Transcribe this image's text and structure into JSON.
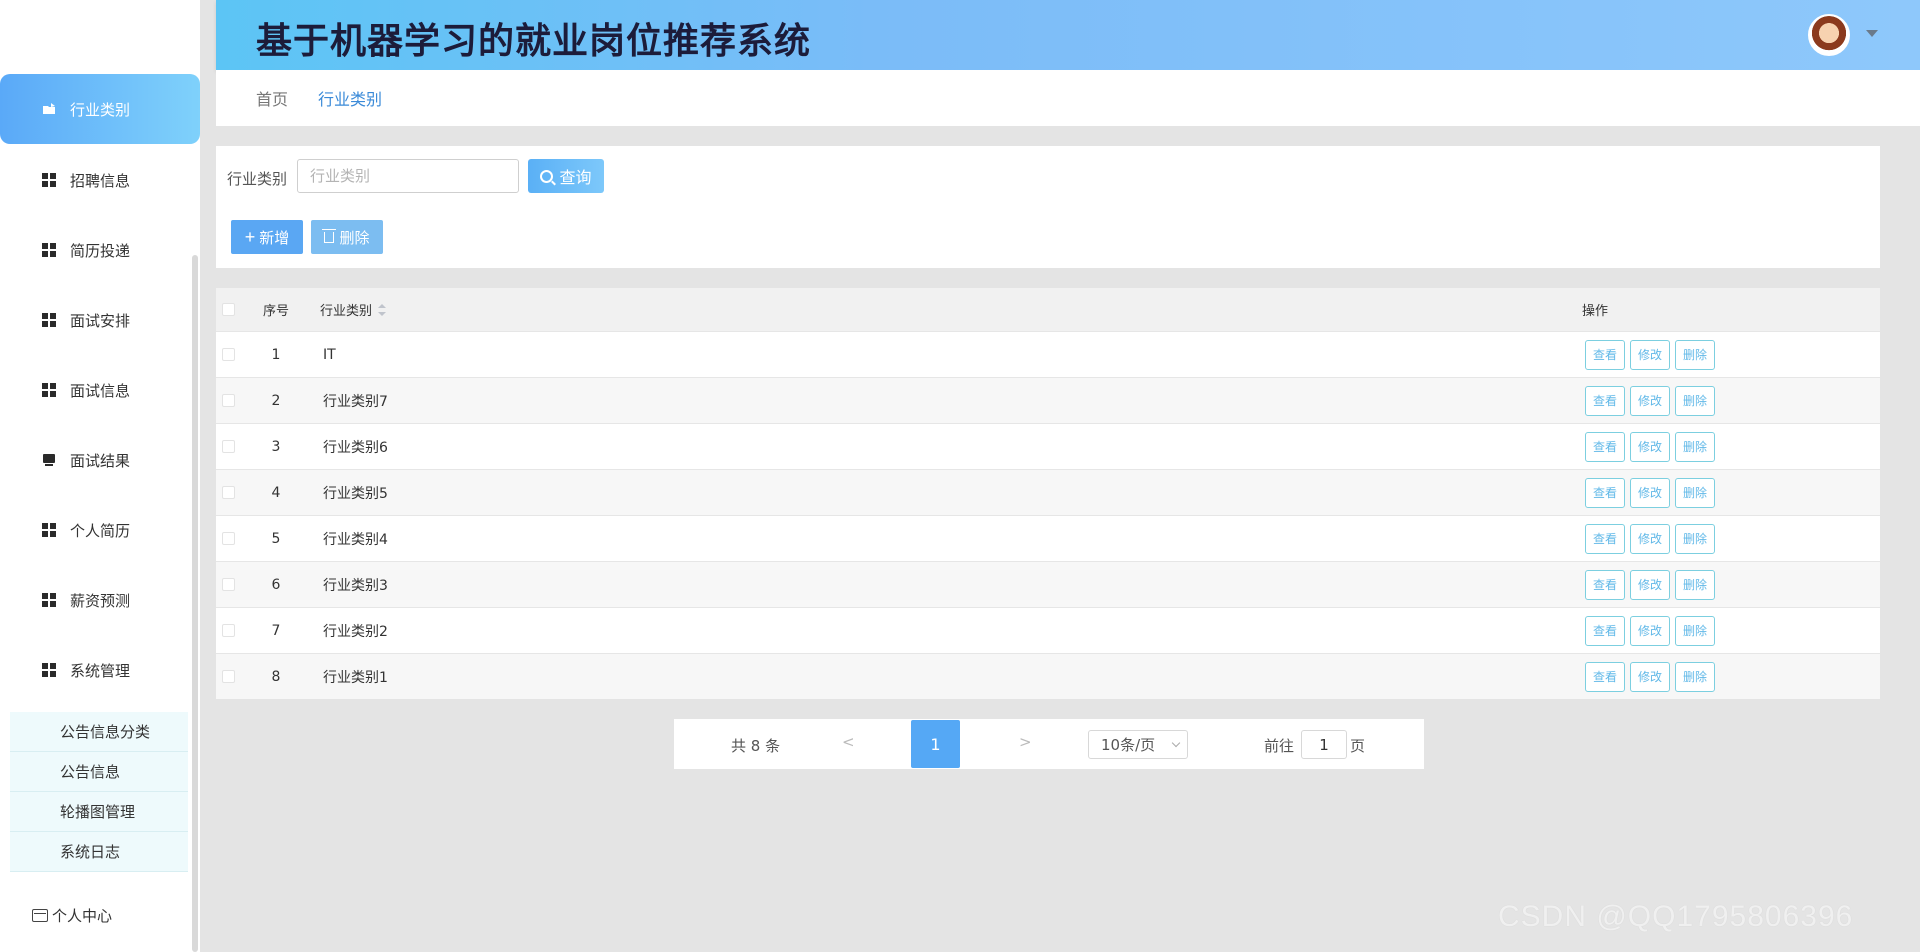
{
  "header": {
    "title": "基于机器学习的就业岗位推荐系统"
  },
  "sidebar": {
    "items": [
      {
        "label": "行业类别",
        "icon": "folder-icon",
        "active": true
      },
      {
        "label": "招聘信息",
        "icon": "grid-icon"
      },
      {
        "label": "简历投递",
        "icon": "grid-icon"
      },
      {
        "label": "面试安排",
        "icon": "grid-icon"
      },
      {
        "label": "面试信息",
        "icon": "grid-icon"
      },
      {
        "label": "面试结果",
        "icon": "monitor-icon"
      },
      {
        "label": "个人简历",
        "icon": "grid-icon"
      },
      {
        "label": "薪资预测",
        "icon": "grid-icon"
      },
      {
        "label": "系统管理",
        "icon": "grid-icon"
      }
    ],
    "submenu": [
      "公告信息分类",
      "公告信息",
      "轮播图管理",
      "系统日志"
    ],
    "personal": "个人中心"
  },
  "breadcrumb": [
    "首页",
    "行业类别"
  ],
  "search": {
    "label": "行业类别",
    "placeholder": "行业类别",
    "button": "查询"
  },
  "actions": {
    "add": "新增",
    "delete": "删除"
  },
  "table": {
    "headers": {
      "index": "序号",
      "name": "行业类别",
      "ops": "操作"
    },
    "rows": [
      {
        "index": "1",
        "name": "IT"
      },
      {
        "index": "2",
        "name": "行业类别7"
      },
      {
        "index": "3",
        "name": "行业类别6"
      },
      {
        "index": "4",
        "name": "行业类别5"
      },
      {
        "index": "5",
        "name": "行业类别4"
      },
      {
        "index": "6",
        "name": "行业类别3"
      },
      {
        "index": "7",
        "name": "行业类别2"
      },
      {
        "index": "8",
        "name": "行业类别1"
      }
    ],
    "op_labels": {
      "view": "查看",
      "edit": "修改",
      "delete": "删除"
    }
  },
  "pagination": {
    "total": "共 8 条",
    "prev": "<",
    "current": "1",
    "next": ">",
    "page_size": "10条/页",
    "goto_label": "前往",
    "goto_value": "1",
    "goto_unit": "页"
  },
  "watermark": "CSDN @QQ1795806396"
}
